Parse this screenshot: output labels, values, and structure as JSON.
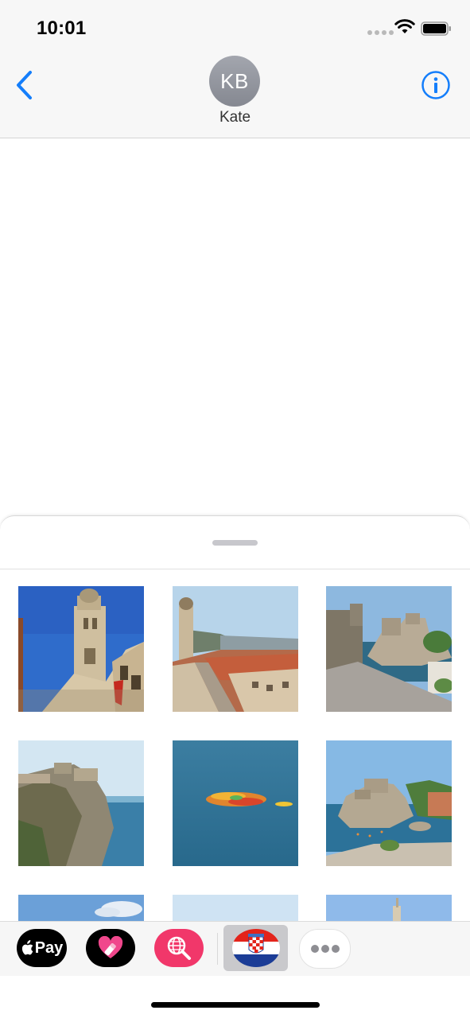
{
  "status_bar": {
    "time": "10:01",
    "icons": [
      "signal-dots-icon",
      "wifi-icon",
      "battery-icon"
    ]
  },
  "nav": {
    "back_icon": "chevron-left-icon",
    "avatar_initials": "KB",
    "contact_name": "Kate",
    "info_icon": "info-icon",
    "accent_color": "#147efb"
  },
  "sticker_drawer": {
    "stickers": [
      {
        "subject": "bell tower against blue sky"
      },
      {
        "subject": "old town street with red roofs"
      },
      {
        "subject": "fortress on rocky coast"
      },
      {
        "subject": "city walls on cliff"
      },
      {
        "subject": "kayaks on the sea"
      },
      {
        "subject": "fortress on cliff with harbor"
      },
      {
        "subject": "sky with clouds"
      },
      {
        "subject": "pale sky"
      },
      {
        "subject": "tower top against sky"
      }
    ]
  },
  "app_strip": {
    "apps": [
      {
        "name": "Apple Pay",
        "label": "Pay",
        "icon": "apple-icon"
      },
      {
        "name": "Digital Touch",
        "icon": "heart-icon"
      },
      {
        "name": "Image Search",
        "icon": "globe-search-icon"
      },
      {
        "name": "Croatia Stickers",
        "icon": "croatia-flag-icon",
        "selected": true
      },
      {
        "name": "More",
        "icon": "more-icon"
      }
    ]
  }
}
